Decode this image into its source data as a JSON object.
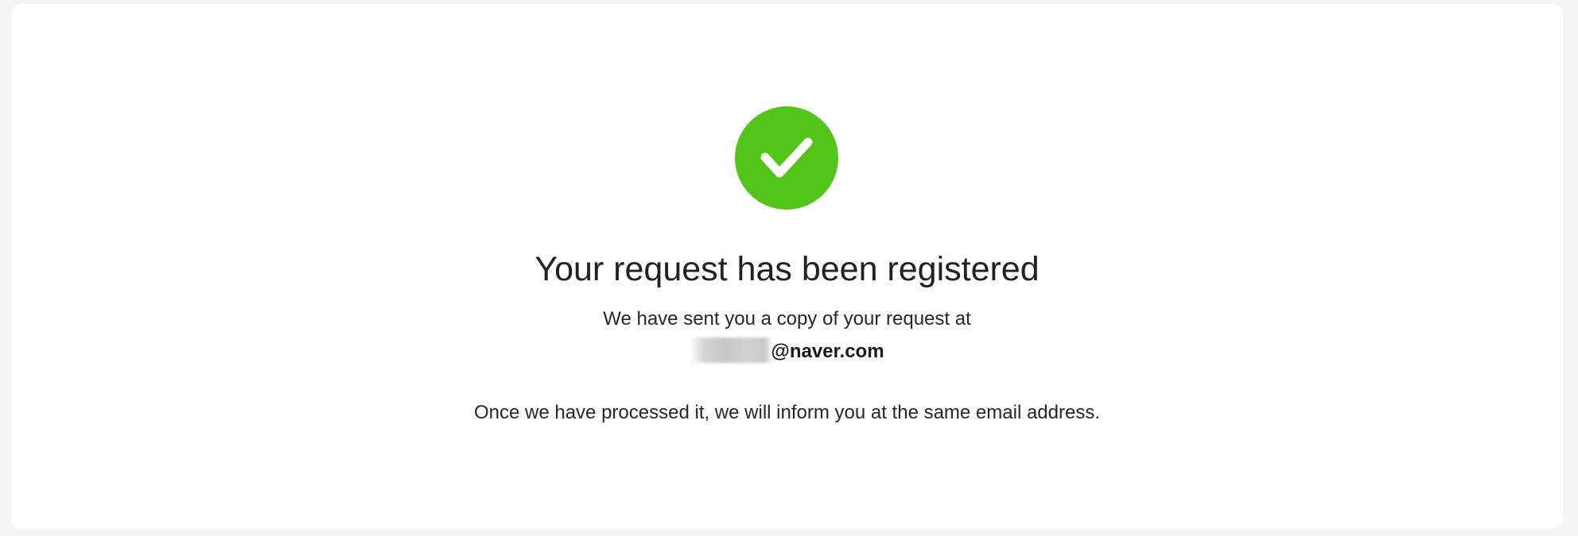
{
  "icon": "check-circle-icon",
  "colors": {
    "success": "#52c41a",
    "text": "#202124",
    "background": "#f4f4f4",
    "card": "#ffffff"
  },
  "confirmation": {
    "title": "Your request has been registered",
    "sent_text": "We have sent you a copy of your request at",
    "email_domain": "@naver.com",
    "info_text": "Once we have processed it, we will inform you at the same email address."
  }
}
